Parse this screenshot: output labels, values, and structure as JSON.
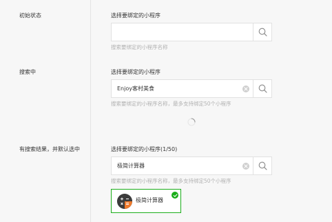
{
  "states": [
    {
      "label": "初始状态",
      "field_title": "选择要绑定的小程序",
      "input_value": "",
      "hint": "搜索要绑定的小程序名称"
    },
    {
      "label": "搜索中",
      "field_title": "选择要绑定的小程序",
      "input_value": "Enjoy客村美食",
      "hint": "搜索要绑定的小程序名称，最多支持绑定50个小程序"
    },
    {
      "label": "有搜索结果，并默认选中",
      "field_title": "选择要绑定的小程序(1/50)",
      "input_value": "极简计算器",
      "hint": "搜索要绑定的小程序名称，最多支持绑定50个小程序"
    }
  ],
  "result": {
    "name": "极简计算器",
    "selected": true
  },
  "colors": {
    "accent": "#1aad19",
    "hint": "#b2b2b2",
    "border": "#e1e1e1",
    "background": "#f7f7f7"
  },
  "icons": {
    "search": "search-icon",
    "clear": "clear-icon",
    "spinner": "loading-spinner-icon",
    "check": "check-icon",
    "app": "calculator-app-icon"
  }
}
